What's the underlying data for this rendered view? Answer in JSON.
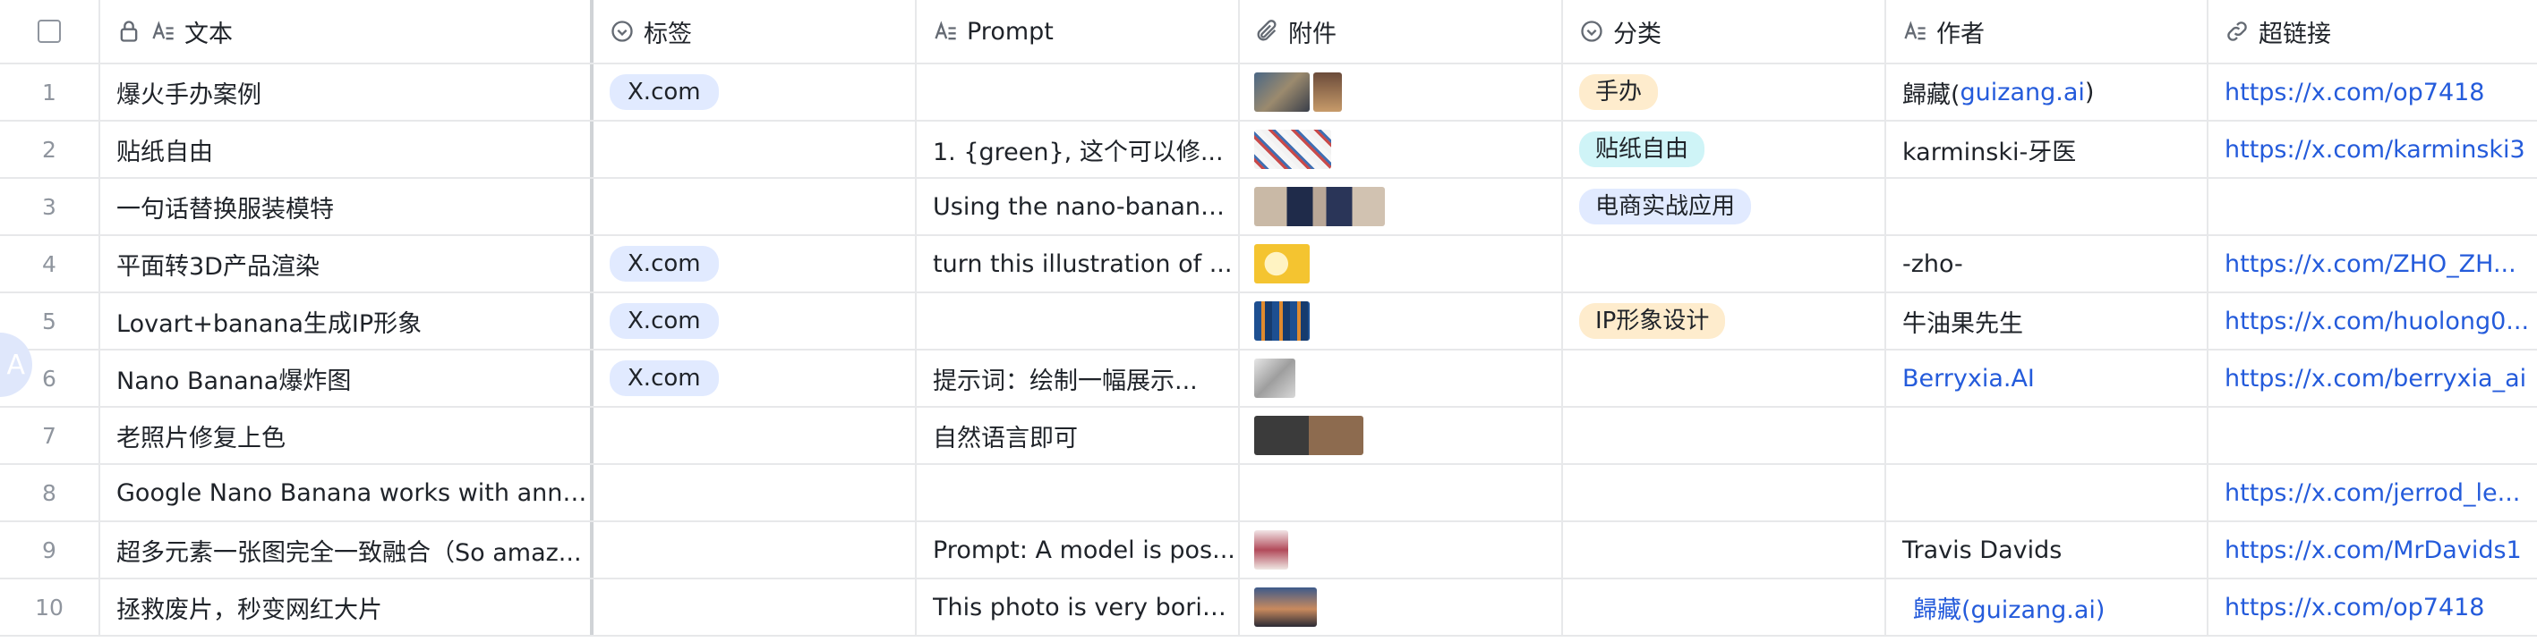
{
  "header": {
    "text_col": "文本",
    "tag_col": "标签",
    "prompt_col": "Prompt",
    "attachment_col": "附件",
    "category_col": "分类",
    "author_col": "作者",
    "link_col": "超链接"
  },
  "rows": [
    {
      "index": "1",
      "text": "爆火手办案例",
      "tag": "X.com",
      "prompt": "",
      "category": "手办",
      "author_name": "歸藏(",
      "author_link": "guizang.ai",
      "author_suffix": ")",
      "link": "https://x.com/op7418"
    },
    {
      "index": "2",
      "text": "贴纸自由",
      "tag": "",
      "prompt": "1. {green}, 这个可以修...",
      "category": "贴纸自由",
      "author_name": "karminski-牙医",
      "link": "https://x.com/karminski3"
    },
    {
      "index": "3",
      "text": "一句话替换服装模特",
      "tag": "",
      "prompt": "Using the nano-banana...",
      "category": "电商实战应用",
      "author_name": "",
      "link": ""
    },
    {
      "index": "4",
      "text": "平面转3D产品渲染",
      "tag": "X.com",
      "prompt": "turn this illustration of ...",
      "category": "",
      "author_name": "-zho-",
      "link": "https://x.com/ZHO_ZH..."
    },
    {
      "index": "5",
      "text": "Lovart+banana生成IP形象",
      "tag": "X.com",
      "prompt": "",
      "category": "IP形象设计",
      "author_name": "牛油果先生",
      "link": "https://x.com/huolong0..."
    },
    {
      "index": "6",
      "text": "Nano Banana爆炸图",
      "tag": "X.com",
      "prompt": "提示词：绘制一幅展示...",
      "category": "",
      "author_name": "Berryxia.AI",
      "link": "https://x.com/berryxia_ai"
    },
    {
      "index": "7",
      "text": "老照片修复上色",
      "tag": "",
      "prompt": "自然语言即可",
      "category": "",
      "author_name": "",
      "link": ""
    },
    {
      "index": "8",
      "text": "Google Nano Banana works with annot...",
      "tag": "",
      "prompt": "",
      "category": "",
      "author_name": "",
      "link": "https://x.com/jerrod_le..."
    },
    {
      "index": "9",
      "text": "超多元素一张图完全一致融合（So amaz...",
      "tag": "",
      "prompt": "Prompt: A model is pos...",
      "category": "",
      "author_name": "Travis Davids",
      "link": "https://x.com/MrDavids1"
    },
    {
      "index": "10",
      "text": "拯救废片，秒变网红大片",
      "tag": "",
      "prompt": "This photo is very borin...",
      "category": "",
      "author_name": "歸藏(guizang.ai)",
      "link": "https://x.com/op7418"
    }
  ],
  "side_avatar_letter": "A",
  "colors": {
    "link": "#245bdb",
    "tag_bg": "#e1eaff",
    "cat_orange": "#feeccd",
    "cat_cyan": "#cff4f7",
    "cat_blue": "#e1eaff",
    "border": "#e7e8ea"
  }
}
